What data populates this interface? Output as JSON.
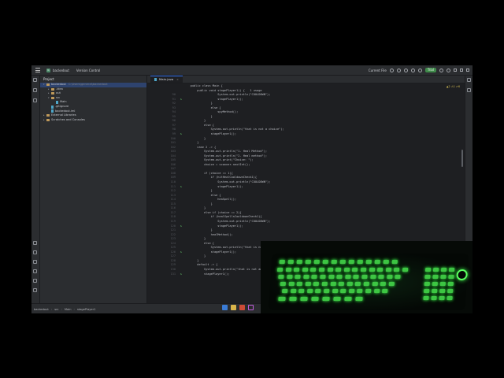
{
  "titlebar": {
    "project_badge": "b",
    "project_name": "backedout",
    "vcs_label": "Version Control",
    "run_config": "Current File",
    "trial_label": "Trial"
  },
  "project_panel": {
    "header": "Project",
    "tree": [
      {
        "label": "backedout",
        "hint": "C:\\Users\\general\\backedout",
        "depth": 0,
        "type": "folder",
        "expanded": true,
        "selected": true
      },
      {
        "label": ".idea",
        "depth": 1,
        "type": "folder",
        "expanded": false
      },
      {
        "label": "out",
        "depth": 1,
        "type": "folder",
        "expanded": false
      },
      {
        "label": "src",
        "depth": 1,
        "type": "folder",
        "expanded": true
      },
      {
        "label": "Main",
        "depth": 2,
        "type": "file"
      },
      {
        "label": ".gitignore",
        "depth": 1,
        "type": "file"
      },
      {
        "label": "backedout.iml",
        "depth": 1,
        "type": "file"
      },
      {
        "label": "External Libraries",
        "depth": 0,
        "type": "folder",
        "expanded": false
      },
      {
        "label": "Scratches and Consoles",
        "depth": 0,
        "type": "folder",
        "expanded": false
      }
    ]
  },
  "editor": {
    "tab_label": "Main.java",
    "inspections": "▲2  ⚠1  ✔6",
    "lines": [
      {
        "n": "",
        "t": "    public class Main {"
      },
      {
        "n": "",
        "t": "        public void stagePlayer1() {   1 usage"
      },
      {
        "n": "90",
        "t": "                    System.out.println(\"COOLDOWN\");"
      },
      {
        "n": "91",
        "t": "                    stagePlayer1();",
        "run": true
      },
      {
        "n": "92",
        "t": "                }"
      },
      {
        "n": "93",
        "t": "                else {"
      },
      {
        "n": "94",
        "t": "                    spyMethod();"
      },
      {
        "n": "95",
        "t": "                }"
      },
      {
        "n": "96",
        "t": "            }"
      },
      {
        "n": "97",
        "t": "            else {"
      },
      {
        "n": "98",
        "t": "                System.out.println(\"that is not a choice\");"
      },
      {
        "n": "99",
        "t": "                stagePlayer1();",
        "run": true
      },
      {
        "n": "100",
        "t": "            }"
      },
      {
        "n": "101",
        "t": "        }"
      },
      {
        "n": "102",
        "t": "        case 2 -> {"
      },
      {
        "n": "103",
        "t": "            System.out.println(\"1. Heal Method\");"
      },
      {
        "n": "104",
        "t": "            System.out.println(\"2. Heal method\");"
      },
      {
        "n": "105",
        "t": "            System.out.print(\"Choice: \");"
      },
      {
        "n": "106",
        "t": "            choice = scanner.nextInt();"
      },
      {
        "n": "107",
        "t": ""
      },
      {
        "n": "108",
        "t": "            if (choice == 1){"
      },
      {
        "n": "109",
        "t": "                if (hitHealCooldownCheck1){"
      },
      {
        "n": "110",
        "t": "                    System.out.println(\"COOLDOWN\");"
      },
      {
        "n": "111",
        "t": "                    stagePlayer1();",
        "run": true
      },
      {
        "n": "112",
        "t": "                }"
      },
      {
        "n": "113",
        "t": "                else {"
      },
      {
        "n": "114",
        "t": "                    heaSpell();"
      },
      {
        "n": "115",
        "t": "                }"
      },
      {
        "n": "116",
        "t": "            }"
      },
      {
        "n": "117",
        "t": "            else if (choice == 2){"
      },
      {
        "n": "118",
        "t": "                if (healSpellsCooldownCheck1){"
      },
      {
        "n": "119",
        "t": "                    System.out.println(\"COOLDOWN\");"
      },
      {
        "n": "120",
        "t": "                    stagePlayer1();",
        "run": true
      },
      {
        "n": "121",
        "t": "                }"
      },
      {
        "n": "122",
        "t": "                healMethod();"
      },
      {
        "n": "123",
        "t": "            }"
      },
      {
        "n": "124",
        "t": "            else {"
      },
      {
        "n": "125",
        "t": "                System.out.println(\"that is not a choice\");"
      },
      {
        "n": "126",
        "t": "                stagePlayer1();",
        "run": true
      },
      {
        "n": "127",
        "t": "            }"
      },
      {
        "n": "128",
        "t": "        }"
      },
      {
        "n": "129",
        "t": "        default -> {"
      },
      {
        "n": "130",
        "t": "            System.out.println(\"that is not an option\");"
      },
      {
        "n": "131",
        "t": "            stagePlayer1();",
        "run": true
      }
    ]
  },
  "statusbar": {
    "crumbs": [
      "backedout",
      "src",
      "Main",
      "stagePlayer1"
    ]
  },
  "colors": {
    "accent": "#3574f0",
    "keyboard_glow": "#44d94a",
    "trial": "#3f8a4a"
  }
}
